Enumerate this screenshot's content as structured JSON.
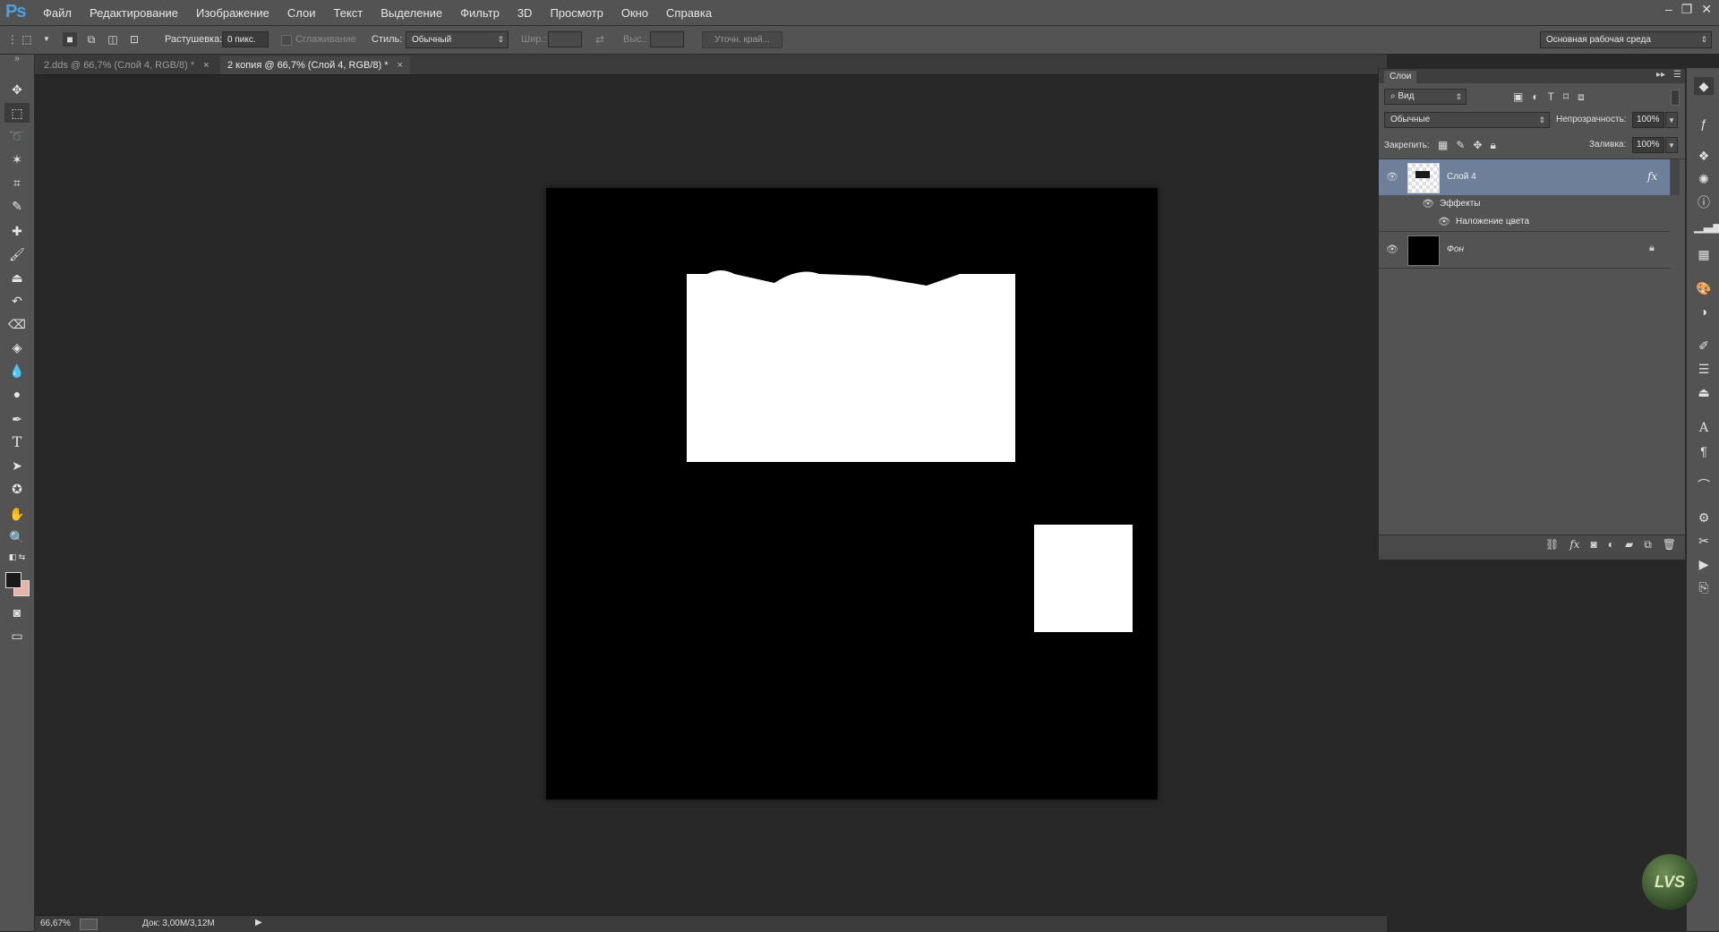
{
  "app": {
    "logo": "Ps",
    "menu": [
      "Файл",
      "Редактирование",
      "Изображение",
      "Слои",
      "Текст",
      "Выделение",
      "Фильтр",
      "3D",
      "Просмотр",
      "Окно",
      "Справка"
    ],
    "window_controls": [
      "–",
      "❐",
      "✕"
    ]
  },
  "options": {
    "feather_label": "Растушевка:",
    "feather_value": "0 пикс.",
    "smoothing_label": "Сглаживание",
    "style_label": "Стиль:",
    "style_value": "Обычный",
    "width_label": "Шир.:",
    "height_label": "Выс.:",
    "refine_button": "Уточн. край...",
    "workspace": "Основная рабочая среда"
  },
  "tabs": [
    {
      "label": "2.dds @ 66,7% (Слой 4, RGB/8) *",
      "close": "×"
    },
    {
      "label": "2 копия @ 66,7% (Слой 4, RGB/8) *",
      "close": "×"
    }
  ],
  "status": {
    "zoom": "66,67%",
    "doc": "Док: 3,00M/3,12M"
  },
  "layers_panel": {
    "title": "Слои",
    "filter_kind": "Вид",
    "blend_mode": "Обычные",
    "opacity_label": "Непрозрачность:",
    "opacity_value": "100%",
    "lock_label": "Закрепить:",
    "fill_label": "Заливка:",
    "fill_value": "100%",
    "layers": [
      {
        "name": "Слой 4",
        "fx": "fx",
        "effects_label": "Эффекты",
        "effect": "Наложение цвета"
      },
      {
        "name": "Фон"
      }
    ]
  },
  "watermark": "LVS",
  "colors": {
    "accent_selected_layer": "#6d7f99",
    "foreground_swatch": "#1a1a1a",
    "background_swatch": "#e8b4aa"
  }
}
